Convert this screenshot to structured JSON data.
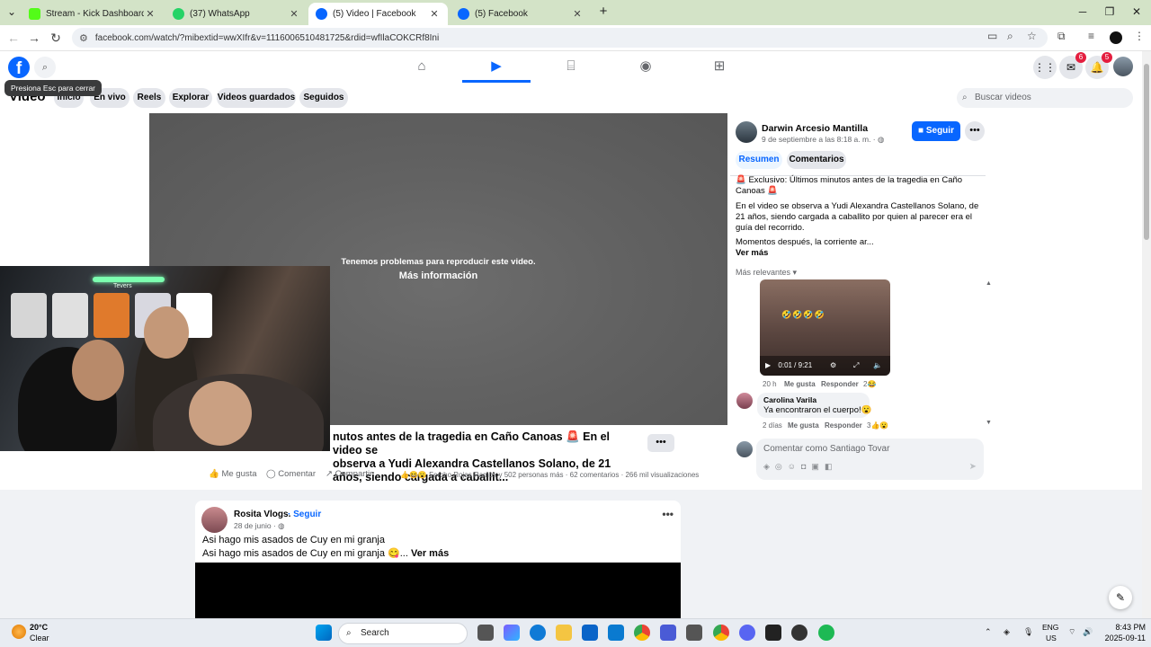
{
  "browser": {
    "tabs": [
      {
        "title": "Stream - Kick Dashboard",
        "fav_color": "#53fc18"
      },
      {
        "title": "(37) WhatsApp",
        "fav_color": "#25d366"
      },
      {
        "title": "(5) Video | Facebook",
        "fav_color": "#0866ff"
      },
      {
        "title": "(5) Facebook",
        "fav_color": "#0866ff"
      }
    ],
    "new_tab": "+",
    "url": "facebook.com/watch/?mibextid=wwXIfr&v=1116006510481725&rdid=wfIlaCOKCRf8Ini"
  },
  "fb": {
    "logo": "f",
    "tooltip": "Presiona Esc para cerrar",
    "badges": {
      "messenger": "6",
      "notifications": "5"
    },
    "nav_icons": [
      "home-icon",
      "video-icon",
      "marketplace-icon",
      "groups-icon",
      "gaming-icon"
    ]
  },
  "subnav": {
    "title": "Video",
    "pills": [
      "Inicio",
      "En vivo",
      "Reels",
      "Explorar",
      "Videos guardados",
      "Seguidos"
    ],
    "search_placeholder": "Buscar videos"
  },
  "video": {
    "error": "Tenemos problemas para reproducir este video.",
    "more_info": "Más información",
    "title_line1": "nutos antes de la tragedia en Caño Canoas 🚨  En el video se",
    "title_line2": "observa a Yudi Alexandra Castellanos Solano, de 21 años, siendo cargada a caballit...",
    "actions": {
      "like": "Me gusta",
      "comment": "Comentar",
      "share": "Compartir"
    },
    "reactions": "Fercho Rojas Ramos y 502 personas más",
    "comments": "62 comentarios",
    "views": "266 mil visualizaciones"
  },
  "webcam": {
    "neon_text": "Tevers"
  },
  "side": {
    "author": "Darwin Arcesio Mantilla",
    "date": "9 de septiembre a las 8:18 a. m. · ",
    "follow": "Seguir",
    "tabs": [
      "Resumen",
      "Comentarios"
    ],
    "desc1": "🚨 Exclusivo: Últimos minutos antes de la tragedia en Caño Canoas 🚨",
    "desc2": "En el video se observa a Yudi Alexandra Castellanos Solano, de 21 años, siendo cargada a caballito por quien al parecer era el guía del recorrido.",
    "desc3": "Momentos después, la corriente ar...",
    "see_more": "Ver más",
    "sort": "Más relevantes",
    "thumb_emojis": "🤣🤣🤣🤣",
    "thumb_time": "0:01 / 9:21",
    "c1_time": "20 h",
    "c1_like": "Me gusta",
    "c1_reply": "Responder",
    "c1_count": "2",
    "c2_author": "Carolina Varila",
    "c2_text": "Ya encontraron el cuerpo!😮",
    "c2_time": "2 días",
    "c2_like": "Me gusta",
    "c2_reply": "Responder",
    "c2_count": "3",
    "compose_placeholder": "Comentar como Santiago Tovar"
  },
  "post2": {
    "name": "Rosita Vlogs.",
    "follow": "· Seguir",
    "date": "28 de junio · ",
    "line1": "Asi hago mis asados de Cuy en mi granja",
    "line2": "Asi hago mis asados de Cuy en mi granja 😋...",
    "see_more": "Ver más"
  },
  "taskbar": {
    "temp": "20°C",
    "weather": "Clear",
    "search": "Search",
    "lang1": "ENG",
    "lang2": "US",
    "time": "8:43 PM",
    "date": "2025-09-11"
  }
}
